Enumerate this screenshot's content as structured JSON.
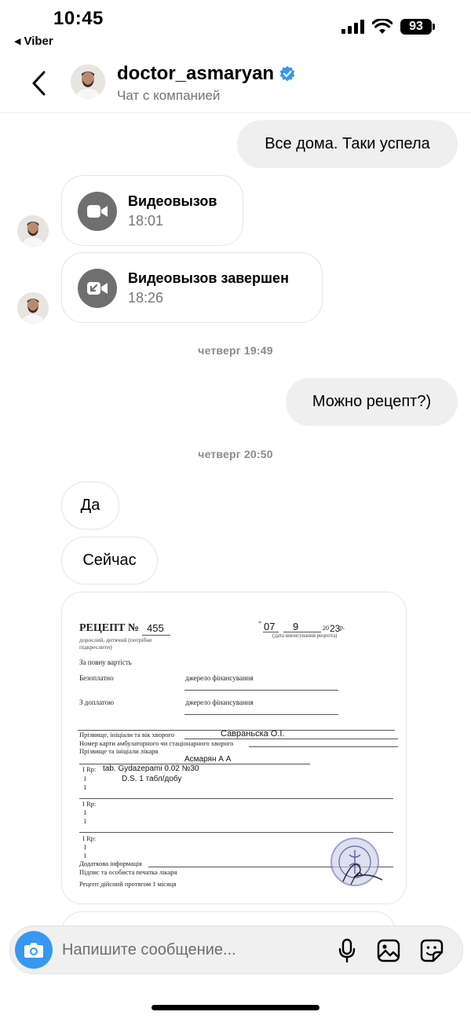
{
  "status_bar": {
    "time": "10:45",
    "back_app": "Viber",
    "battery": "93"
  },
  "header": {
    "name": "doctor_asmaryan",
    "subtitle": "Чат с компанией",
    "verified_color": "#3897f0"
  },
  "messages": {
    "out_1": "Все дома. Таки успела",
    "call_1": {
      "title": "Видеовызов",
      "time": "18:01",
      "icon": "video-camera-icon"
    },
    "call_2": {
      "title": "Видеовызов завершен",
      "time": "18:26",
      "icon": "video-call-ended-icon"
    },
    "timestamp_1": "четверг 19:49",
    "out_2": "Можно рецепт?)",
    "timestamp_2": "четверг 20:50",
    "in_1": "Да",
    "in_2": "Сейчас"
  },
  "prescription": {
    "title": "РЕЦЕПТ №",
    "number": "455",
    "subtitle_1": "дорослий, дитячий (потрібне",
    "subtitle_2": "підкреслити)",
    "date_quote": "\"",
    "date_day": "07",
    "date_month": "9",
    "date_year_prefix": "20",
    "date_year": "23",
    "date_suffix": "р.",
    "date_caption": "(дата виписування рецепта)",
    "full_price": "За повну вартість",
    "free": "Безоплатно",
    "funding_1": "джерело фінансування",
    "copay": "З доплатою",
    "funding_2": "джерело фінансування",
    "patient_label": "Прізвище, ініціали та вік хворого",
    "patient_value": "Савраньска О.І.",
    "card_label": "Номер карти амбулаторного чи стаціонарного хворого",
    "doctor_label": "Прізвище та ініціали лікаря",
    "doctor_value": "Асмарян А А",
    "rp_1": "I Rp:",
    "rx_line_1": "tab. Gydazepami 0.02 №30",
    "rx_line_2": "D.S. 1 табл/добу",
    "rp_2": "I Rp:",
    "rp_3": "I Rp:",
    "extra_info": "Додаткова інформація",
    "signature_label": "Підпис та особиста печатка лікаря",
    "validity": "Рецепт дійсний протягом 1 місяця"
  },
  "composer": {
    "placeholder": "Напишите сообщение...",
    "camera_icon": "camera-icon",
    "mic_icon": "microphone-icon",
    "gallery_icon": "gallery-icon",
    "sticker_icon": "sticker-icon",
    "accent": "#3897f0"
  }
}
